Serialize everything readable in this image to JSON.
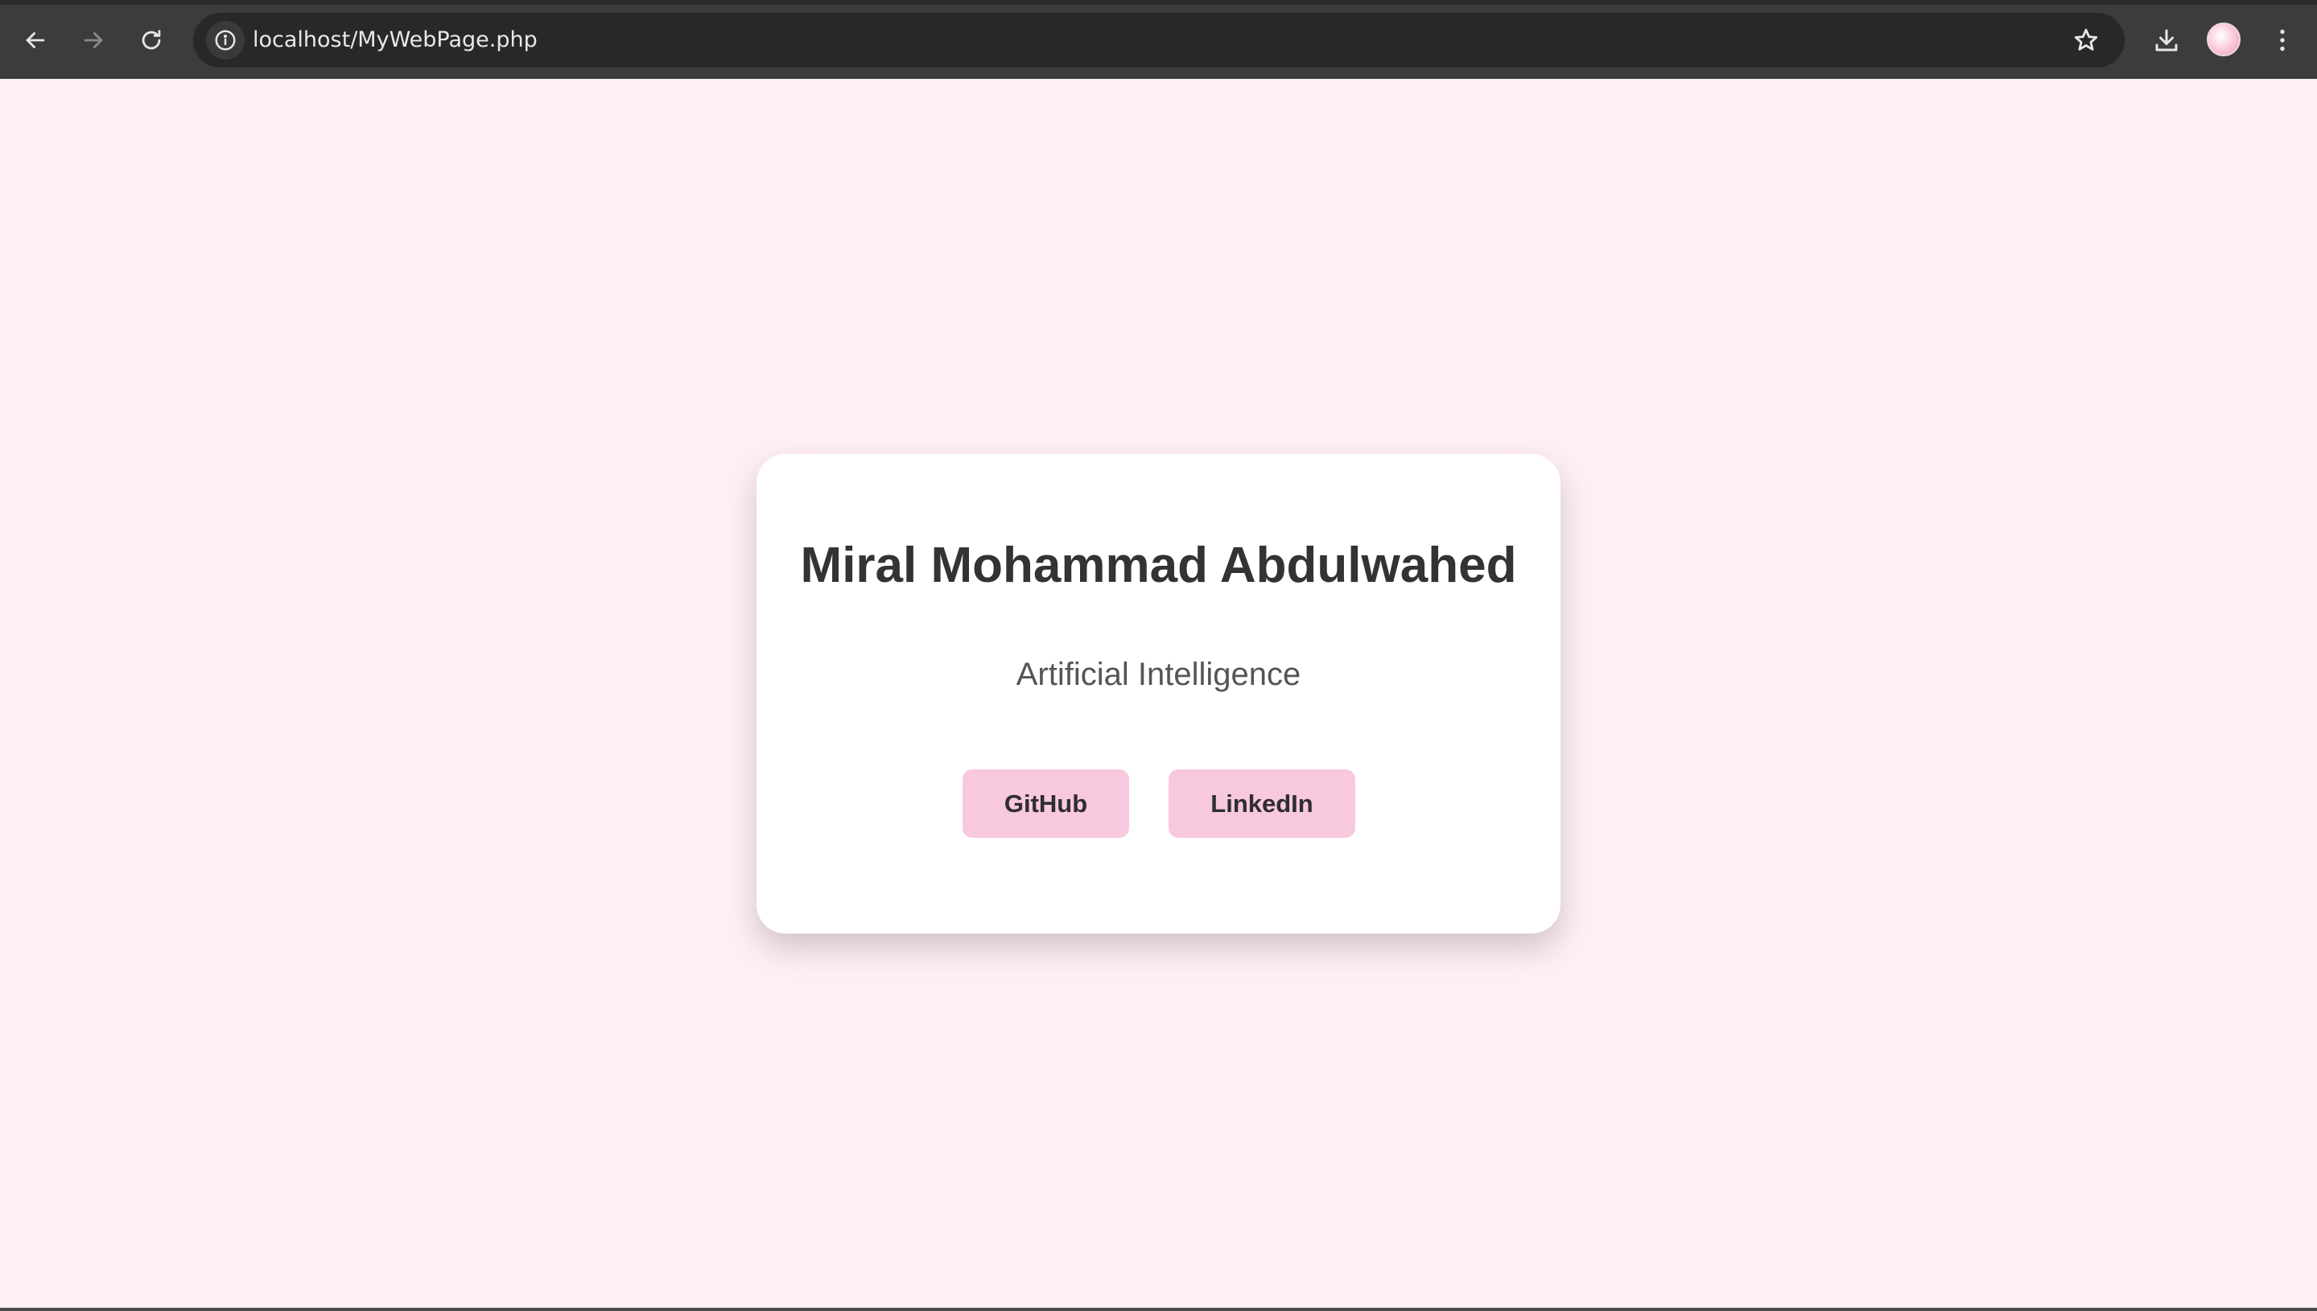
{
  "browser": {
    "url": "localhost/MyWebPage.php",
    "icons": {
      "back": "arrow-left-icon",
      "forward": "arrow-right-icon",
      "reload": "reload-icon",
      "site_info": "info-icon",
      "bookmark": "star-icon",
      "download": "download-icon",
      "menu": "kebab-menu-icon"
    }
  },
  "card": {
    "name": "Miral Mohammad Abdulwahed",
    "field": "Artificial Intelligence",
    "buttons": {
      "github": "GitHub",
      "linkedin": "LinkedIn"
    }
  },
  "colors": {
    "page_background": "#ffeef6",
    "card_background": "#ffffff",
    "button_background": "#f8c8df",
    "heading_text": "#333333",
    "toolbar": "#3c3c3c"
  }
}
